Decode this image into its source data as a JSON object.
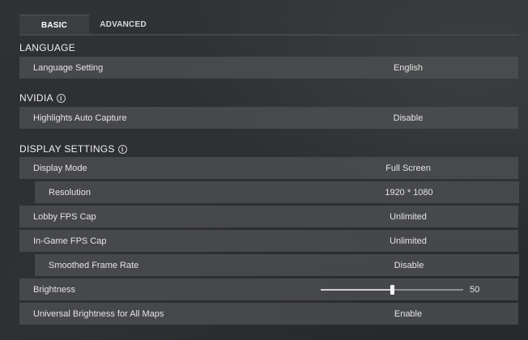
{
  "tabs": {
    "basic": "BASIC",
    "advanced": "ADVANCED"
  },
  "sections": {
    "language": {
      "title": "LANGUAGE",
      "rows": [
        {
          "label": "Language Setting",
          "value": "English"
        }
      ]
    },
    "nvidia": {
      "title": "NVIDIA",
      "info_icon": "info-icon",
      "rows": [
        {
          "label": "Highlights Auto Capture",
          "value": "Disable"
        }
      ]
    },
    "display": {
      "title": "DISPLAY SETTINGS",
      "info_icon": "info-icon",
      "rows": [
        {
          "label": "Display Mode",
          "value": "Full Screen"
        },
        {
          "label": "Resolution",
          "value": "1920 * 1080"
        },
        {
          "label": "Lobby FPS Cap",
          "value": "Unlimited"
        },
        {
          "label": "In-Game FPS Cap",
          "value": "Unlimited"
        },
        {
          "label": "Smoothed Frame Rate",
          "value": "Disable"
        },
        {
          "label": "Brightness",
          "value": "50",
          "slider_fraction": 0.5
        },
        {
          "label": "Universal Brightness for All Maps",
          "value": "Enable"
        }
      ]
    }
  },
  "colors": {
    "background": "#2b2e31",
    "row": "#4e5052",
    "text": "#e4e4e4",
    "active_tab": "#3b3e41"
  }
}
